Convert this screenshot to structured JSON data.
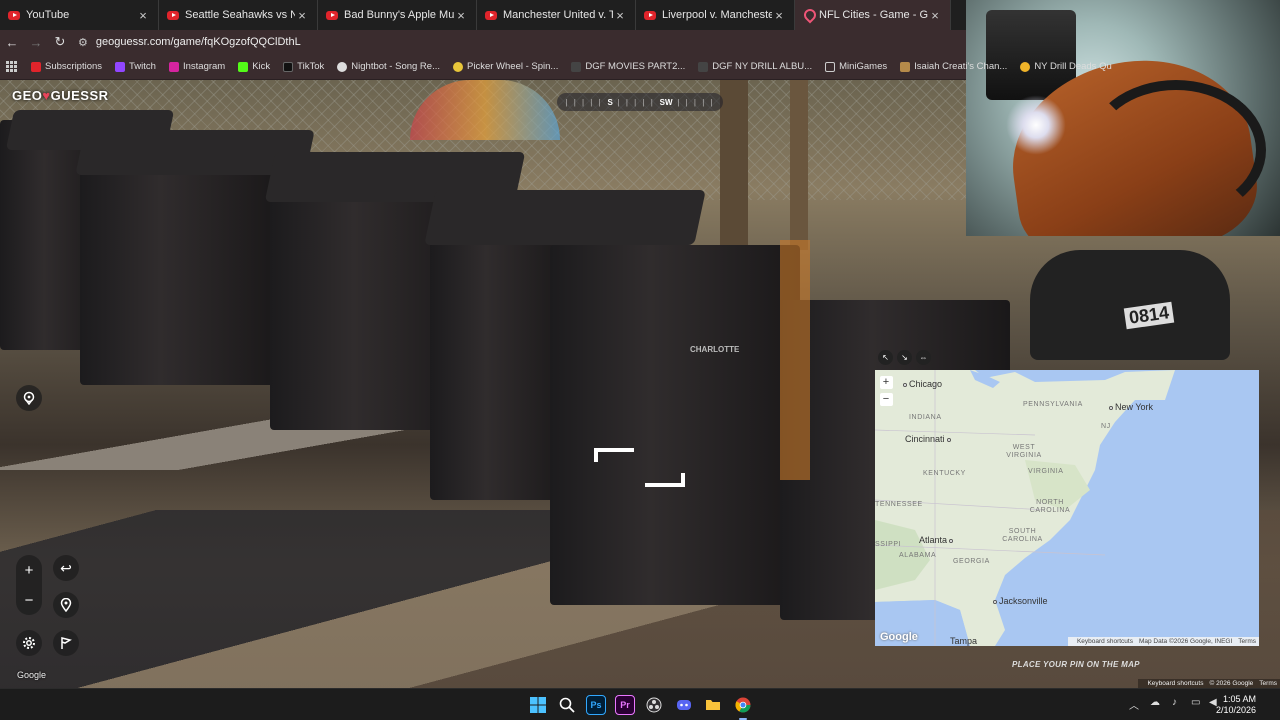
{
  "browser": {
    "tabs": [
      {
        "title": "YouTube",
        "icon": "youtube-icon"
      },
      {
        "title": "Seattle Seahawks vs New Engla",
        "icon": "youtube-icon"
      },
      {
        "title": "Bad Bunny's Apple Music Super",
        "icon": "youtube-icon"
      },
      {
        "title": "Manchester United v. Tottenha",
        "icon": "youtube-icon"
      },
      {
        "title": "Liverpool v. Manchester City | P",
        "icon": "youtube-icon"
      },
      {
        "title": "NFL Cities - Game - GeoGuessr",
        "icon": "geoguessr-icon",
        "active": true
      }
    ],
    "close_glyph": "×",
    "url": "geoguessr.com/game/fqKOgzofQQClDthL",
    "bookmarks": [
      {
        "label": "Subscriptions",
        "color": "#e0242b"
      },
      {
        "label": "Twitch",
        "color": "#9146ff"
      },
      {
        "label": "Instagram",
        "color": "#d6249f"
      },
      {
        "label": "Kick",
        "color": "#53fc18"
      },
      {
        "label": "TikTok",
        "color": "#222222"
      },
      {
        "label": "Nightbot - Song Re...",
        "color": "#dddddd"
      },
      {
        "label": "Picker Wheel - Spin...",
        "color": "#e8c63a"
      },
      {
        "label": "DGF MOVIES PART2...",
        "color": "#444444"
      },
      {
        "label": "DGF NY DRILL ALBU...",
        "color": "#444444"
      },
      {
        "label": "MiniGames",
        "color": "#888888"
      },
      {
        "label": "Isaiah Creati's Chan...",
        "color": "#b58a4a"
      },
      {
        "label": "NY Drill Deads Qu",
        "color": "#f0b429"
      }
    ]
  },
  "game": {
    "logo_left": "GEO",
    "logo_pin": "♥",
    "logo_right": "GUESSR",
    "compass": {
      "ticks": "| | | | |",
      "heading_1": "S",
      "heading_2": "SW"
    },
    "controls": {
      "zoom_in": "+",
      "zoom_out": "−",
      "undo": "↩"
    },
    "street_view_watermark": "Google",
    "place_pin_hint": "PLACE YOUR PIN ON THE MAP",
    "street_view_attribution": [
      "Keyboard shortcuts",
      "© 2026 Google",
      "Terms"
    ],
    "bin_label": "0814",
    "bin_brand": "CHARLOTTE"
  },
  "map": {
    "cities": [
      {
        "name": "Chicago"
      },
      {
        "name": "New York"
      },
      {
        "name": "Cincinnati"
      },
      {
        "name": "Atlanta"
      },
      {
        "name": "Jacksonville"
      },
      {
        "name": "Tampa"
      }
    ],
    "states": [
      "PENNSYLVANIA",
      "INDIANA",
      "WEST VIRGINIA",
      "KENTUCKY",
      "VIRGINIA",
      "TENNESSEE",
      "NORTH CAROLINA",
      "SOUTH CAROLINA",
      "SSIPPI",
      "ALABAMA",
      "GEORGIA",
      "NJ"
    ],
    "google_logo": "Google",
    "attribution": [
      "Keyboard shortcuts",
      "Map Data ©2026 Google, INEGI",
      "Terms"
    ],
    "zoom_in": "+",
    "zoom_out": "−"
  },
  "taskbar": {
    "time": "1:05 AM",
    "date": "2/10/2026",
    "apps": [
      "windows-start",
      "search",
      "photoshop",
      "premiere",
      "obs",
      "discord",
      "file-explorer",
      "chrome"
    ],
    "photoshop_label": "Ps",
    "premiere_label": "Pr"
  }
}
